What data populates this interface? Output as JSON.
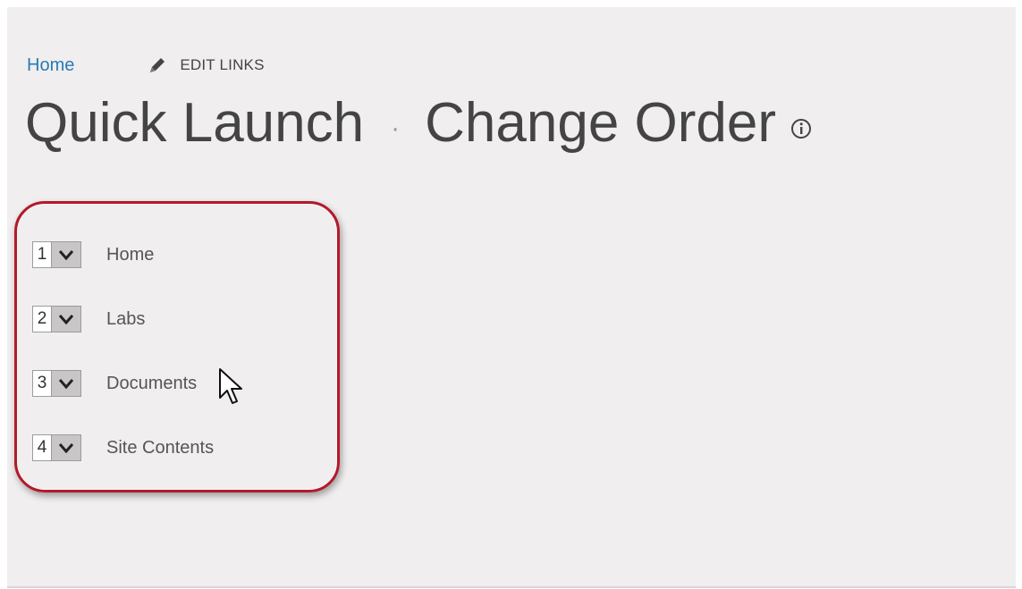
{
  "nav": {
    "home_link": "Home",
    "edit_links_label": "EDIT LINKS"
  },
  "page": {
    "title_part1": "Quick Launch",
    "title_separator": "·",
    "title_part2": "Change Order"
  },
  "order_items": [
    {
      "position": "1",
      "label": "Home"
    },
    {
      "position": "2",
      "label": "Labs"
    },
    {
      "position": "3",
      "label": "Documents"
    },
    {
      "position": "4",
      "label": "Site Contents"
    }
  ],
  "colors": {
    "link": "#2a7bb8",
    "highlight_border": "#b3192b",
    "background": "#f0eeee"
  },
  "icons": {
    "edit": "pencil-icon",
    "info": "info-icon",
    "dropdown": "chevron-down-icon",
    "cursor": "mouse-pointer-icon"
  }
}
